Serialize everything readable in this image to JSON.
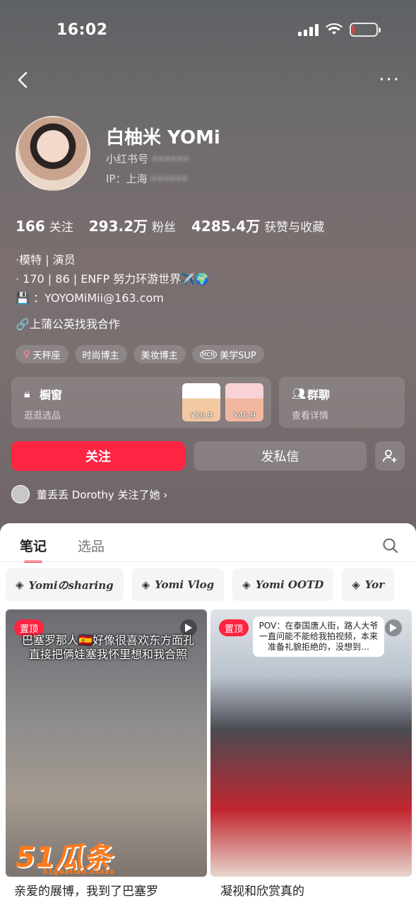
{
  "status_bar": {
    "time": "16:02",
    "battery_level_fraction": 0.1,
    "battery_color": "#ff3b30"
  },
  "header": {
    "back_icon": "chevron-left-icon",
    "more_icon": "more-dots-icon",
    "more_text": "···"
  },
  "profile": {
    "name": "白柚米 YOMi",
    "redbook_id_label": "小红书号",
    "redbook_id_value": "",
    "ip_label": "IP：上海",
    "stats": [
      {
        "value": "166",
        "label": "关注"
      },
      {
        "value": "293.2万",
        "label": "粉丝"
      },
      {
        "value": "4285.4万",
        "label": "获赞与收藏"
      }
    ],
    "bio_lines": [
      "·模特 | 演员",
      "· 170 | 86 | ENFP  努力环游世界✈️🌍",
      "💾 ：YOYOMiMii@163.com"
    ],
    "link_text": "🔗上蒲公英找我合作",
    "tags": [
      {
        "icon": "♀",
        "label": "天秤座"
      },
      {
        "icon": "",
        "label": "时尚博主"
      },
      {
        "icon": "",
        "label": "美妆博主"
      },
      {
        "icon": "MCN",
        "label": "美学SUP"
      }
    ]
  },
  "shop": {
    "title": "橱窗",
    "subtitle": "逛逛选品",
    "icon": "bag-icon",
    "products": [
      {
        "price": "¥36.9"
      },
      {
        "price": "¥46.9"
      }
    ]
  },
  "group_chat": {
    "title": "群聊",
    "subtitle": "查看详情",
    "icon": "people-icon"
  },
  "actions": {
    "follow": "关注",
    "message": "发私信",
    "add_icon": "add-friend-icon"
  },
  "mutual": {
    "text": "董丢丢 Dorothy 关注了她 ›"
  },
  "tabs": [
    {
      "label": "笔记",
      "active": true
    },
    {
      "label": "选品",
      "active": false
    }
  ],
  "collections": [
    "Yomiのsharing",
    "Yomi Vlog",
    "Yomi OOTD",
    "Yor"
  ],
  "notes": [
    {
      "pin": "置顶",
      "caption": "巴塞罗那人🇪🇸好像很喜欢东方面孔直接把俩娃塞我怀里想和我合照",
      "title": "亲爱的展博，我到了巴塞罗"
    },
    {
      "pin": "置顶",
      "caption": "POV：在泰国唐人街，路人大爷一直问能不能给我拍视频，本来准备礼貌拒绝的，没想到…",
      "title": "凝视和欣赏真的"
    }
  ],
  "watermark": {
    "big": "51瓜条",
    "small": "51guatiao.xxxxx"
  },
  "colors": {
    "accent": "#ff2442"
  }
}
